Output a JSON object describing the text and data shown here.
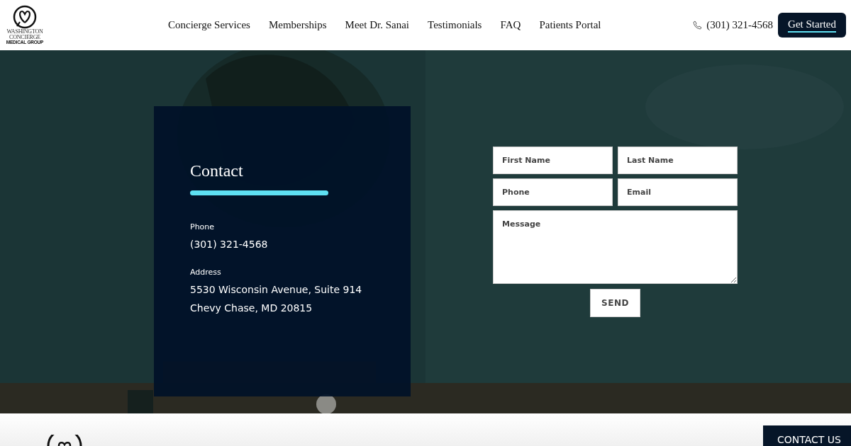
{
  "header": {
    "logo": {
      "lines": [
        "WASHINGTON",
        "CONCIERGE",
        "MEDICAL GROUP"
      ]
    },
    "nav": [
      {
        "label": "Concierge Services"
      },
      {
        "label": "Memberships"
      },
      {
        "label": "Meet Dr. Sanai"
      },
      {
        "label": "Testimonials"
      },
      {
        "label": "FAQ"
      },
      {
        "label": "Patients Portal"
      }
    ],
    "phone": "(301) 321-4568",
    "cta": "Get Started"
  },
  "hero": {
    "contact_card": {
      "title": "Contact",
      "items": [
        {
          "label": "Phone",
          "lines": [
            "(301) 321-4568"
          ]
        },
        {
          "label": "Address",
          "lines": [
            "5530 Wisconsin Avenue, Suite 914",
            "Chevy Chase, MD 20815"
          ]
        }
      ]
    },
    "form": {
      "fields": [
        {
          "kind": "input",
          "placeholder": "First Name"
        },
        {
          "kind": "input",
          "placeholder": "Last Name"
        },
        {
          "kind": "input",
          "placeholder": "Phone"
        },
        {
          "kind": "input",
          "placeholder": "Email"
        },
        {
          "kind": "textarea",
          "placeholder": "Message"
        }
      ],
      "submit": "SEND"
    }
  },
  "footer": {
    "button": "CONTACT US"
  }
}
